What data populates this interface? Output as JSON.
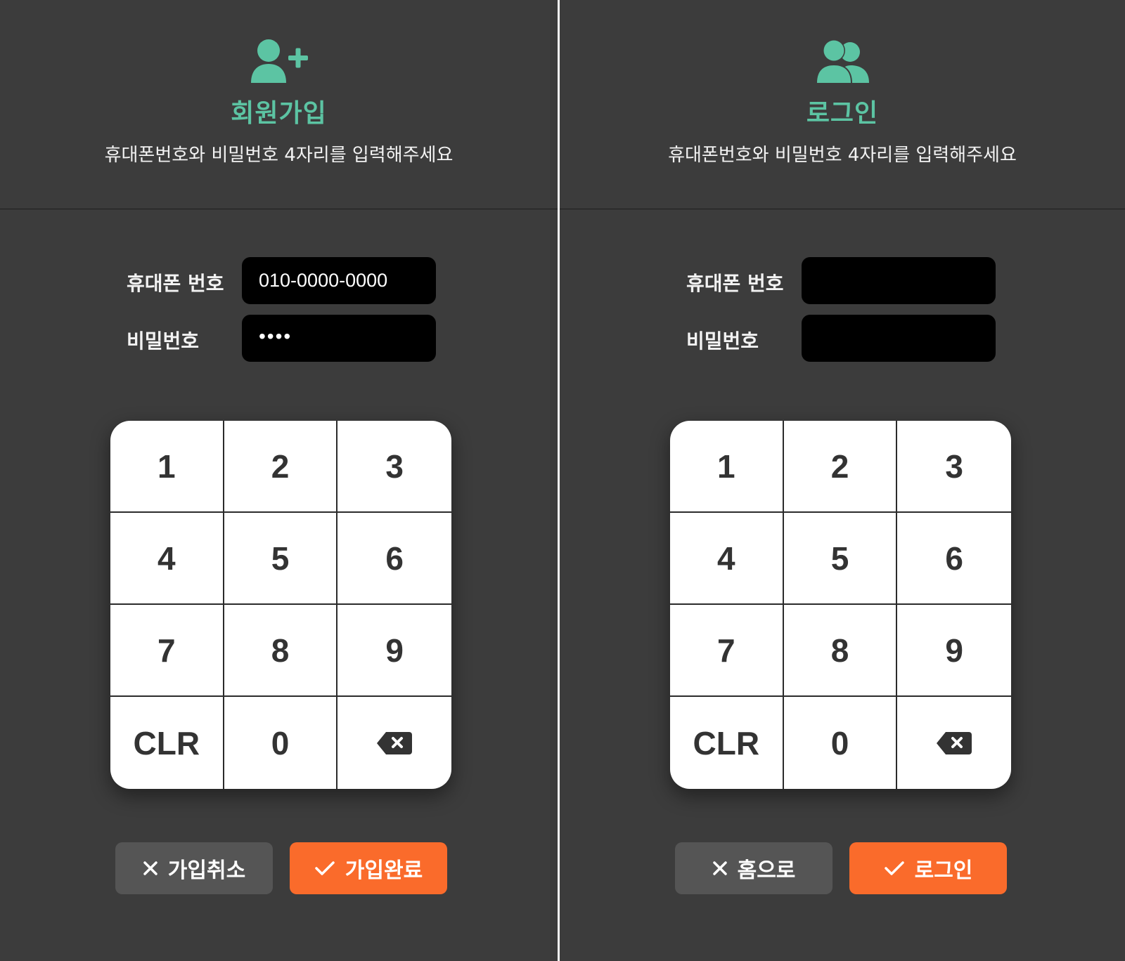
{
  "colors": {
    "background": "#3c3c3c",
    "accent_green": "#5cc4a3",
    "accent_orange": "#fa6b2b",
    "cancel_gray": "#555555",
    "input_bg": "#000000"
  },
  "signup": {
    "icon": "user-plus-icon",
    "title": "회원가입",
    "description": "휴대폰번호와 비밀번호 4자리를 입력해주세요",
    "phone_label": "휴대폰 번호",
    "phone_value": "010-0000-0000",
    "password_label": "비밀번호",
    "password_value": "••••",
    "keypad": [
      "1",
      "2",
      "3",
      "4",
      "5",
      "6",
      "7",
      "8",
      "9",
      "CLR",
      "0"
    ],
    "cancel_label": "가입취소",
    "confirm_label": "가입완료"
  },
  "login": {
    "icon": "users-icon",
    "title": "로그인",
    "description": "휴대폰번호와 비밀번호 4자리를 입력해주세요",
    "phone_label": "휴대폰 번호",
    "phone_value": "",
    "password_label": "비밀번호",
    "password_value": "",
    "keypad": [
      "1",
      "2",
      "3",
      "4",
      "5",
      "6",
      "7",
      "8",
      "9",
      "CLR",
      "0"
    ],
    "cancel_label": "홈으로",
    "confirm_label": "로그인"
  }
}
